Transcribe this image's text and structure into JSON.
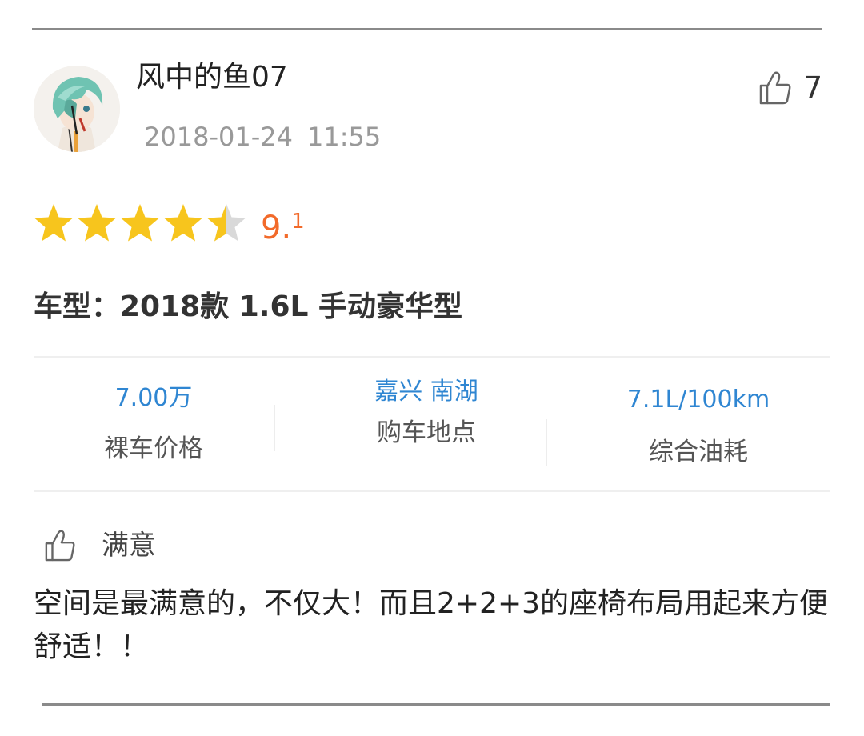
{
  "user": {
    "name": "风中的鱼07",
    "date": "2018-01-24",
    "time": "11:55",
    "avatar_icon": "anime-avatar"
  },
  "likes": {
    "count": "7",
    "icon": "thumbs-up-icon"
  },
  "rating": {
    "stars_filled": 4.5,
    "stars_total": 5,
    "score_int": "9.",
    "score_dec": "1",
    "star_color": "#f7c51d",
    "score_color": "#f26a2a"
  },
  "model": {
    "text": "车型：2018款 1.6L 手动豪华型"
  },
  "stats": [
    {
      "value": "7.00万",
      "label": "裸车价格"
    },
    {
      "value": "嘉兴 南湖",
      "label": "购车地点"
    },
    {
      "value": "7.1L/100km",
      "label": "综合油耗"
    }
  ],
  "satisfaction": {
    "label": "满意",
    "text": "空间是最满意的，不仅大！而且2+2+3的座椅布局用起来方便舒适！！"
  },
  "colors": {
    "accent_blue": "#2f86d2",
    "rule": "#8a8a8a"
  }
}
